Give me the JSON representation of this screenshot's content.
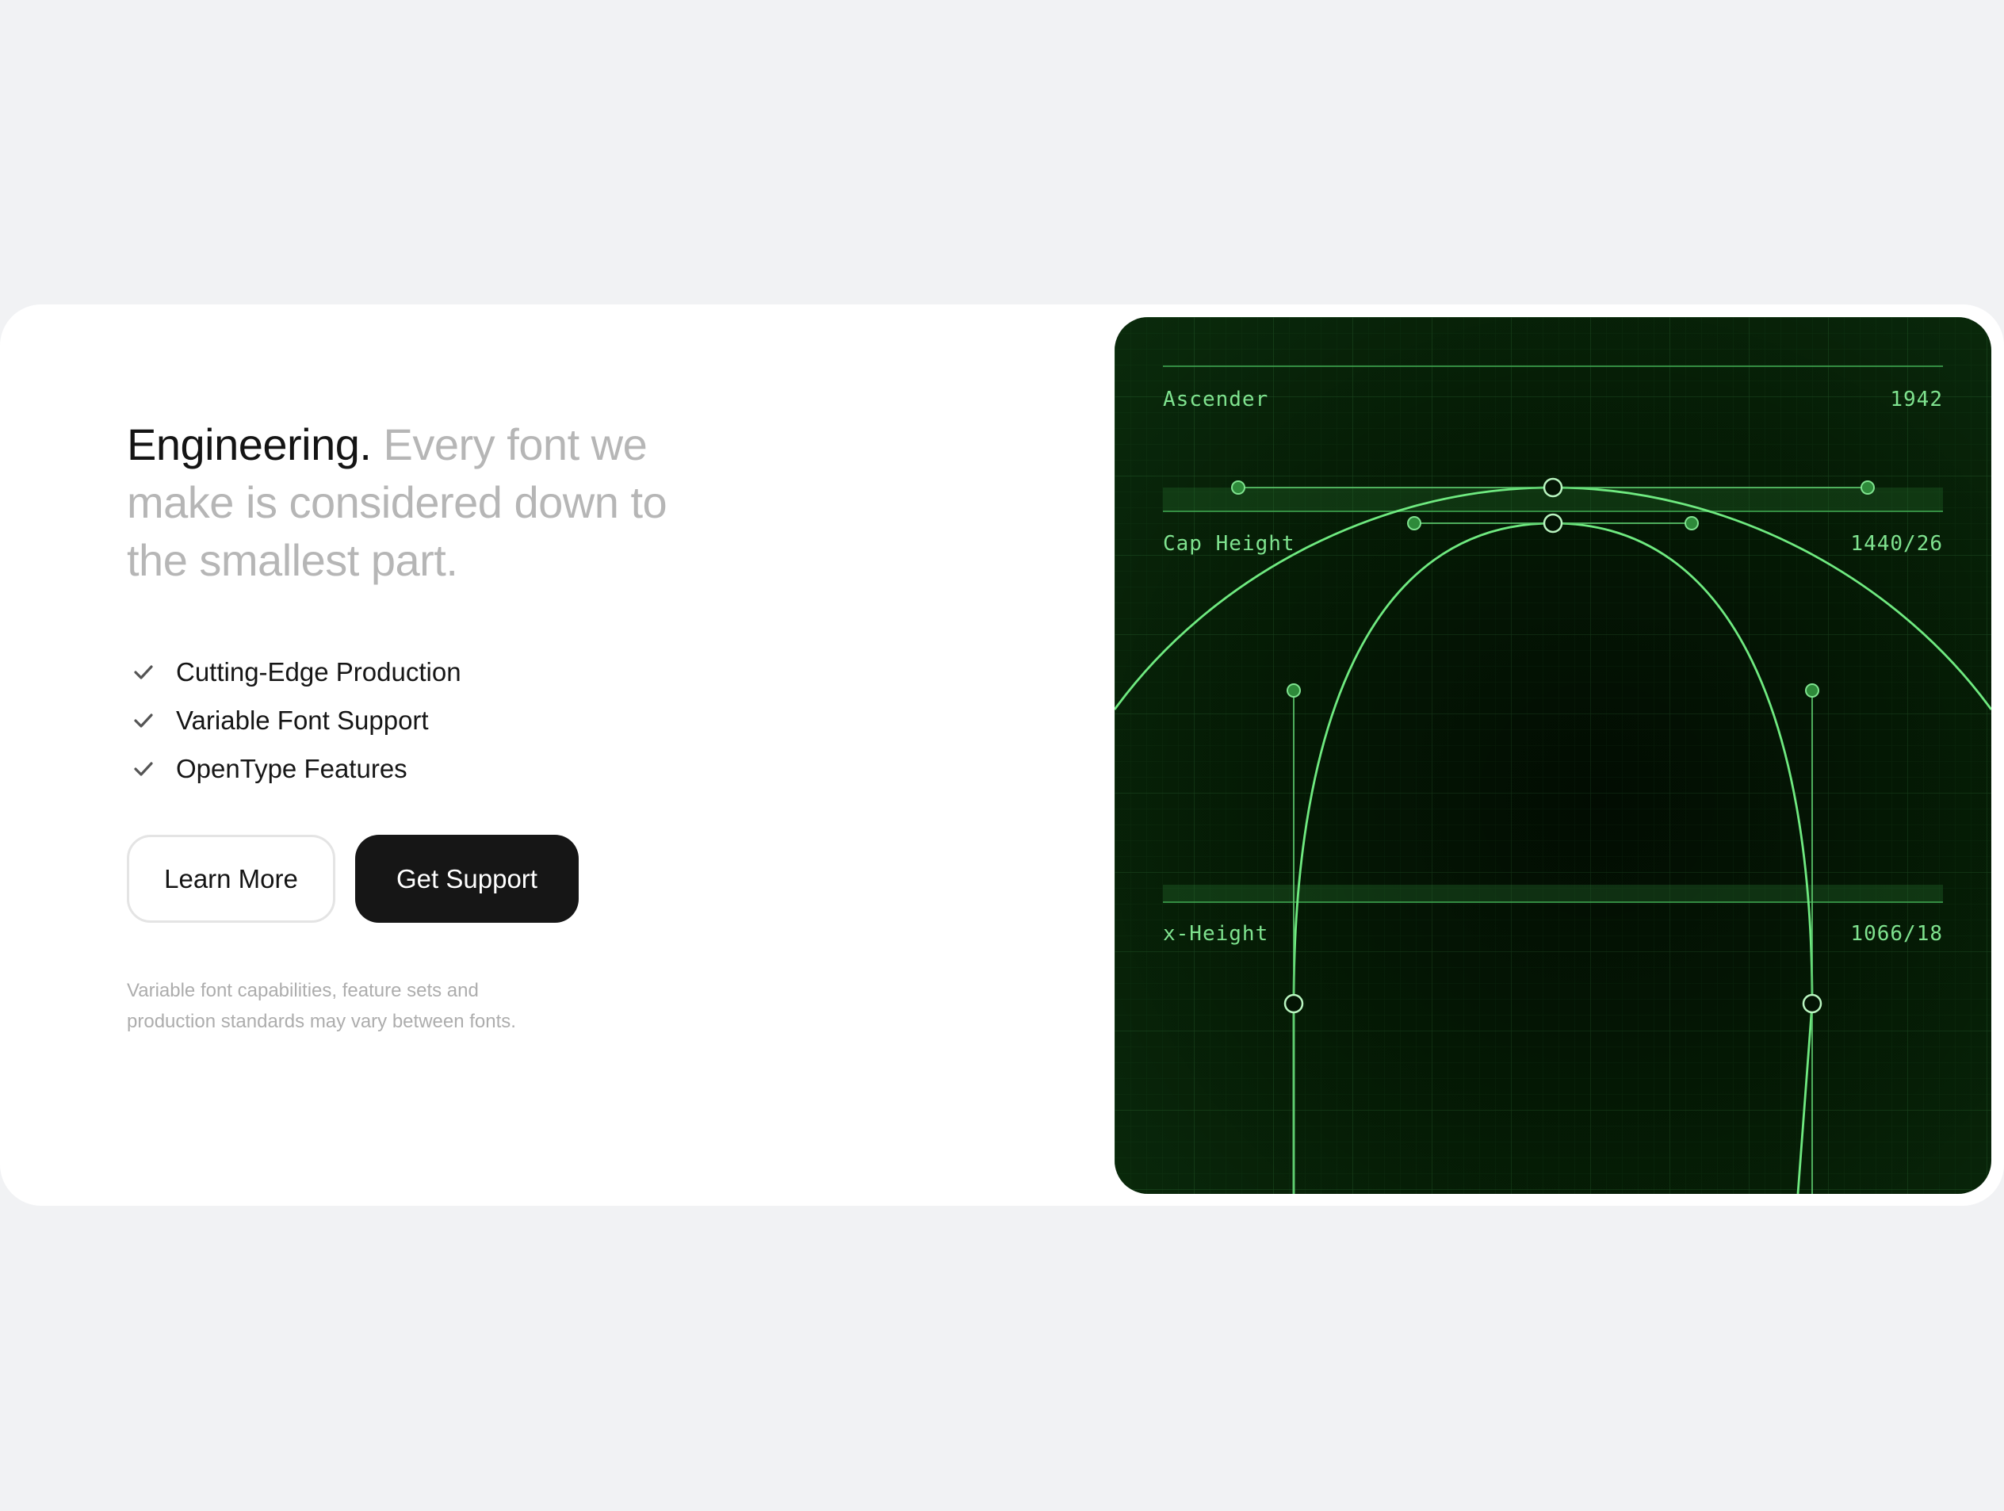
{
  "headline": {
    "strong": "Engineering.",
    "muted": "Every font we make is considered down to the smallest part."
  },
  "features": [
    {
      "label": "Cutting-Edge Production",
      "icon": "check-icon"
    },
    {
      "label": "Variable Font Support",
      "icon": "check-icon"
    },
    {
      "label": "OpenType Features",
      "icon": "check-icon"
    }
  ],
  "buttons": {
    "learn_more": "Learn More",
    "get_support": "Get Support"
  },
  "note": "Variable font capabilities, feature sets and production standards may vary between fonts.",
  "metrics": {
    "ascender": {
      "label": "Ascender",
      "value": "1942"
    },
    "cap_height": {
      "label": "Cap Height",
      "value": "1440/26"
    },
    "x_height": {
      "label": "x-Height",
      "value": "1066/18"
    }
  },
  "colors": {
    "background": "#f1f2f4",
    "card": "#ffffff",
    "panel": "#062006",
    "accent_green": "#7fe38f",
    "primary_button": "#161616"
  }
}
